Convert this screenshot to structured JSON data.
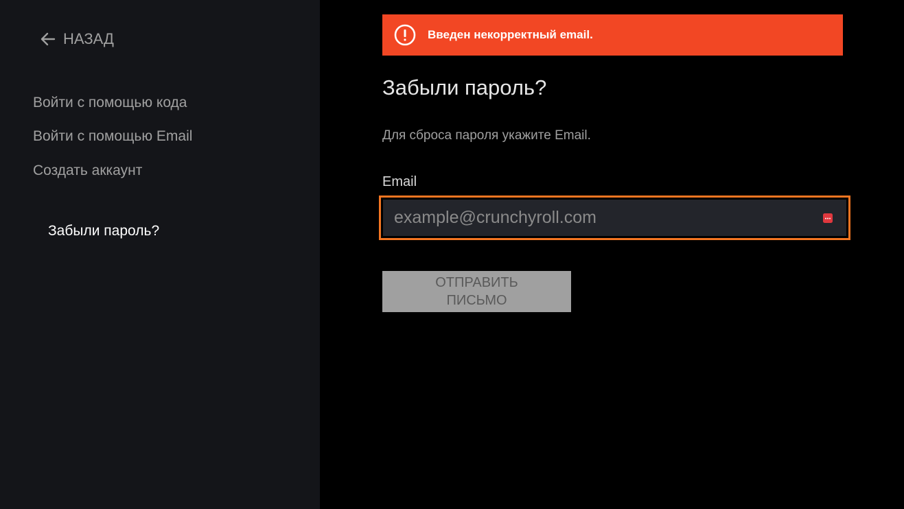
{
  "sidebar": {
    "back_label": "НАЗАД",
    "items": [
      {
        "label": "Войти с помощью кода"
      },
      {
        "label": "Войти с помощью Email"
      },
      {
        "label": "Создать аккаунт"
      }
    ],
    "active_item": {
      "label": "Забыли пароль?"
    }
  },
  "alert": {
    "icon": "error-icon",
    "message": "Введен некорректный email.",
    "color": "#f24724"
  },
  "form": {
    "title": "Забыли пароль?",
    "subtitle": "Для сброса пароля укажите Email.",
    "email_label": "Email",
    "email_placeholder": "example@crunchyroll.com",
    "email_value": "",
    "submit_line1": "ОТПРАВИТЬ",
    "submit_line2": "ПИСЬМО"
  },
  "colors": {
    "accent": "#f47521",
    "error": "#f24724",
    "sidebar_bg": "#141519",
    "main_bg": "#000000",
    "button_disabled": "#a0a0a0"
  }
}
